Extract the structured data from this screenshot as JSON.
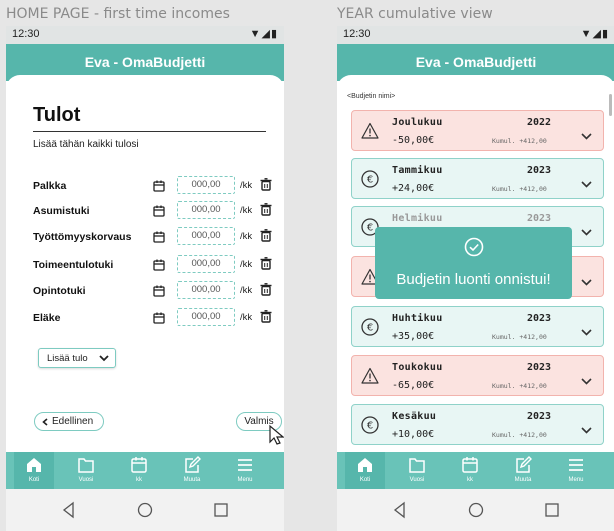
{
  "frames": {
    "left_label": "HOME PAGE - first time incomes",
    "right_label": "YEAR cumulative view"
  },
  "status": {
    "time": "12:30"
  },
  "app": {
    "title": "Eva - OmaBudjetti"
  },
  "income_page": {
    "title": "Tulot",
    "subtitle": "Lisää tähän kaikki tulosi",
    "amount_placeholder": "000,00",
    "unit": "/kk",
    "rows": [
      {
        "label": "Palkka"
      },
      {
        "label": "Asumistuki"
      },
      {
        "label": "Työttömyyskorvaus"
      },
      {
        "label": "Toimeentulotuki"
      },
      {
        "label": "Opintotuki"
      },
      {
        "label": "Eläke"
      }
    ],
    "add_button": "Lisää tulo",
    "prev_button": "Edellinen",
    "done_button": "Valmis"
  },
  "nav": {
    "items": [
      {
        "label": "Koti",
        "icon": "home-icon"
      },
      {
        "label": "Vuosi",
        "icon": "folder-icon"
      },
      {
        "label": "kk",
        "icon": "calendar-icon"
      },
      {
        "label": "Muuta",
        "icon": "edit-icon"
      },
      {
        "label": "Menu",
        "icon": "menu-icon"
      }
    ],
    "active_left": "Koti",
    "active_right": "Koti"
  },
  "year_view": {
    "budget_name": "<Budjetin nimi>",
    "months": [
      {
        "name": "Joulukuu",
        "year": "2022",
        "value": "-50,00€",
        "cumulative": "Kumul. +412,00",
        "status": "negative",
        "icon": "warning-icon"
      },
      {
        "name": "Tammikuu",
        "year": "2023",
        "value": "+24,00€",
        "cumulative": "Kumul. +412,00",
        "status": "positive",
        "icon": "euro-icon"
      },
      {
        "name": "Helmikuu",
        "year": "2023",
        "value": "",
        "cumulative": "",
        "status": "positive",
        "icon": "euro-icon"
      },
      {
        "name": "",
        "year": "",
        "value": "",
        "cumulative": "",
        "status": "negative",
        "icon": "warning-icon"
      },
      {
        "name": "Huhtikuu",
        "year": "2023",
        "value": "+35,00€",
        "cumulative": "Kumul. +412,00",
        "status": "positive",
        "icon": "euro-icon"
      },
      {
        "name": "Toukokuu",
        "year": "2023",
        "value": "-65,00€",
        "cumulative": "Kumul. +412,00",
        "status": "negative",
        "icon": "warning-icon"
      },
      {
        "name": "Kesäkuu",
        "year": "2023",
        "value": "+10,00€",
        "cumulative": "Kumul. +412,00",
        "status": "positive",
        "icon": "euro-icon"
      }
    ],
    "toast": "Budjetin luonti onnistui!"
  },
  "colors": {
    "accent": "#56b6ab",
    "nav": "#69c3b8",
    "negative_bg": "#fbe3e0",
    "positive_bg": "#e8f6f4"
  }
}
